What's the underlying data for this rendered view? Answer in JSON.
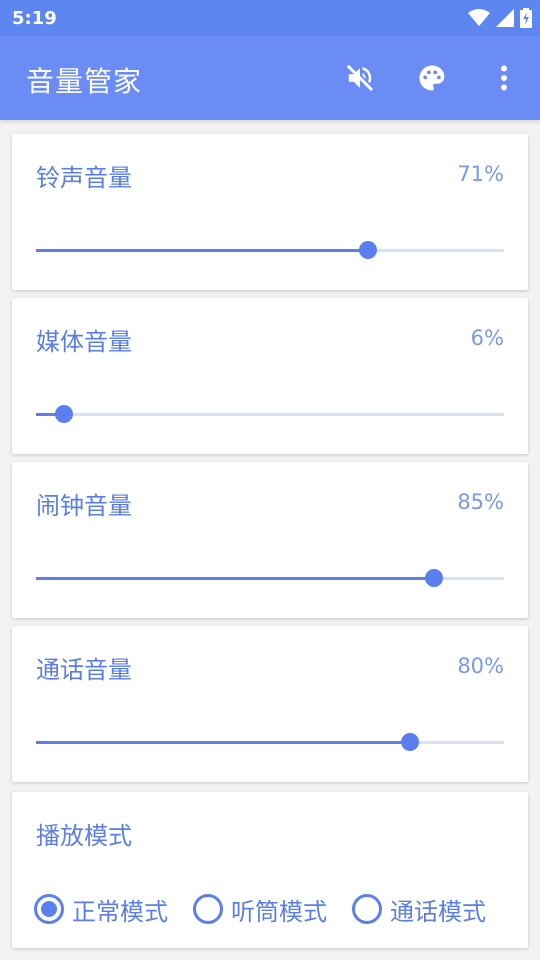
{
  "status_bar": {
    "time": "5:19",
    "icons": [
      "wifi-icon",
      "cell-signal-icon",
      "battery-charging-icon"
    ]
  },
  "app_bar": {
    "title": "音量管家",
    "actions": [
      "mute-icon",
      "palette-icon",
      "more-vert-icon"
    ]
  },
  "colors": {
    "primary": "#6b8cf4",
    "accent": "#5b7fee",
    "track": "#d7e1fb",
    "text": "#5b7ee6"
  },
  "volumes": [
    {
      "label": "铃声音量",
      "value_text": "71%",
      "level": 0.71
    },
    {
      "label": "媒体音量",
      "value_text": "6%",
      "level": 0.06
    },
    {
      "label": "闹钟音量",
      "value_text": "85%",
      "level": 0.85
    },
    {
      "label": "通话音量",
      "value_text": "80%",
      "level": 0.8
    }
  ],
  "play_mode": {
    "title": "播放模式",
    "options": [
      {
        "label": "正常模式",
        "selected": true
      },
      {
        "label": "听筒模式",
        "selected": false
      },
      {
        "label": "通话模式",
        "selected": false
      }
    ]
  }
}
